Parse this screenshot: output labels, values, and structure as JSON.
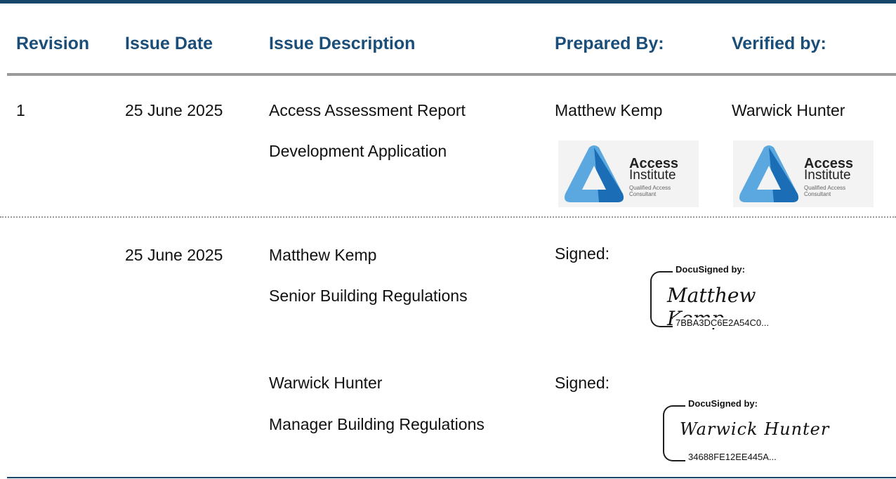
{
  "headers": {
    "revision": "Revision",
    "issue_date": "Issue Date",
    "issue_description": "Issue Description",
    "prepared_by": "Prepared By:",
    "verified_by": "Verified by:"
  },
  "revision_row": {
    "revision": "1",
    "date": "25 June 2025",
    "description_line1": "Access Assessment Report",
    "description_line2": "Development Application",
    "prepared_by": "Matthew Kemp",
    "verified_by": "Warwick Hunter"
  },
  "logo": {
    "line1": "Access",
    "line2": "Institute",
    "line3": "Qualified Access",
    "line4": "Consultant",
    "icon": "access-institute-logo-icon",
    "colors": {
      "dark": "#1b6db5",
      "light": "#5ba8e0"
    }
  },
  "signoffs": [
    {
      "date": "25 June 2025",
      "name": "Matthew Kemp",
      "title": "Senior Building Regulations",
      "signed_label": "Signed:",
      "docusign_header": "DocuSigned by:",
      "signature": "Matthew Kemp",
      "envelope_id": "7BBA3DC6E2A54C0..."
    },
    {
      "name": "Warwick Hunter",
      "title": "Manager Building Regulations",
      "signed_label": "Signed:",
      "docusign_header": "DocuSigned by:",
      "signature": "Warwick Hunter",
      "envelope_id": "34688FE12EE445A..."
    }
  ],
  "colors": {
    "header_text": "#1a4e78",
    "rule": "#17466b",
    "divider": "#9a9a9a"
  }
}
